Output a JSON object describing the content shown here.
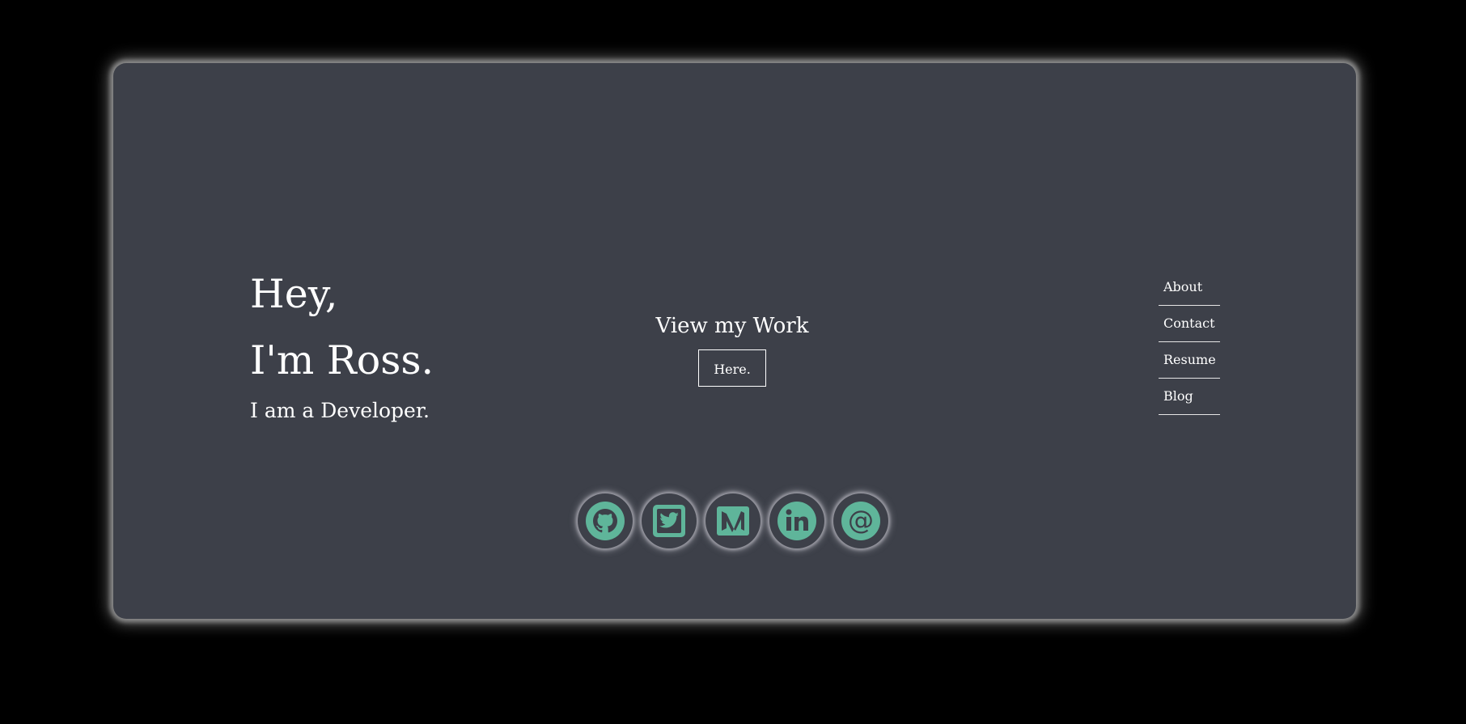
{
  "colors": {
    "background": "#000000",
    "card": "#3d4049",
    "text": "#ffffff",
    "accent": "#5fb59a"
  },
  "intro": {
    "line1": "Hey,",
    "line2": "I'm Ross.",
    "subtitle": "I am a Developer."
  },
  "work": {
    "title": "View my Work",
    "button_label": "Here."
  },
  "nav": {
    "items": [
      {
        "label": "About"
      },
      {
        "label": "Contact"
      },
      {
        "label": "Resume"
      },
      {
        "label": "Blog"
      }
    ]
  },
  "social": {
    "icons": [
      "github-icon",
      "twitter-icon",
      "medium-icon",
      "linkedin-icon",
      "email-icon"
    ]
  }
}
